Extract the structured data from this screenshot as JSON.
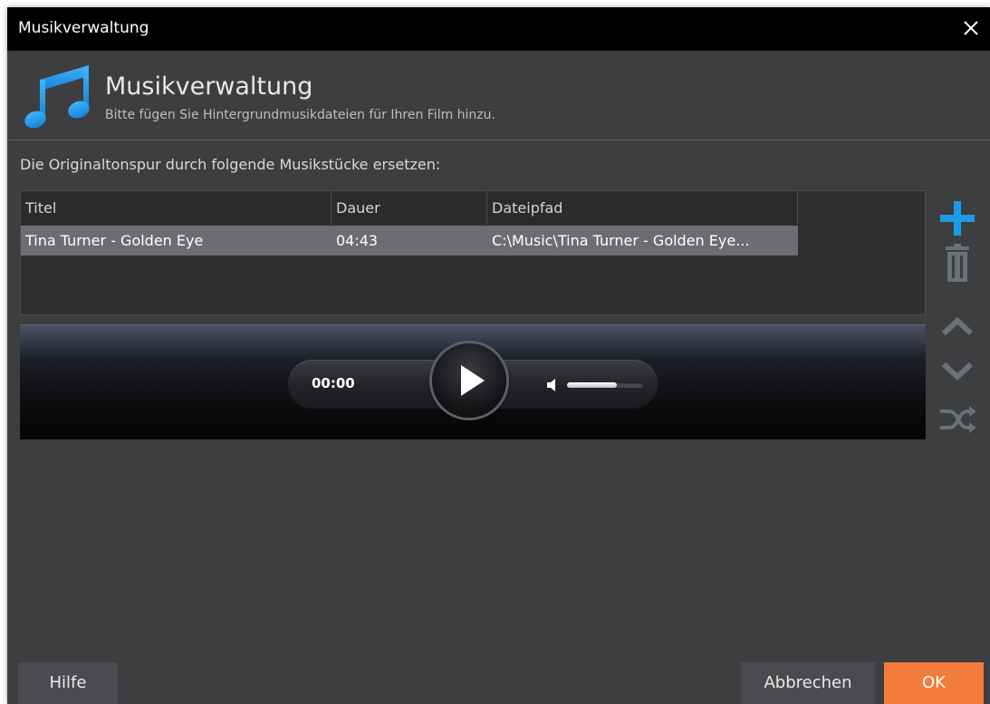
{
  "window": {
    "title": "Musikverwaltung"
  },
  "header": {
    "title": "Musikverwaltung",
    "subtitle": "Bitte fügen Sie Hintergrundmusikdateien für Ihren Film hinzu."
  },
  "instruction": "Die Originaltonspur durch folgende Musikstücke ersetzen:",
  "table": {
    "columns": [
      "Titel",
      "Dauer",
      "Dateipfad"
    ],
    "rows": [
      {
        "title": "Tina Turner - Golden Eye",
        "duration": "04:43",
        "path": "C:\\Music\\Tina Turner - Golden Eye..."
      }
    ]
  },
  "player": {
    "time": "00:00",
    "volume_fraction": 0.65
  },
  "side_tools": {
    "icons": [
      "plus-icon",
      "trash-icon",
      "chevron-up-icon",
      "chevron-down-icon",
      "shuffle-icon"
    ],
    "accent": "#1e9be8",
    "disabled": "#6c7079"
  },
  "footer": {
    "help": "Hilfe",
    "cancel": "Abbrechen",
    "ok": "OK"
  },
  "colors": {
    "ok_button": "#f37b3b",
    "accent_blue": "#1e9be8"
  }
}
